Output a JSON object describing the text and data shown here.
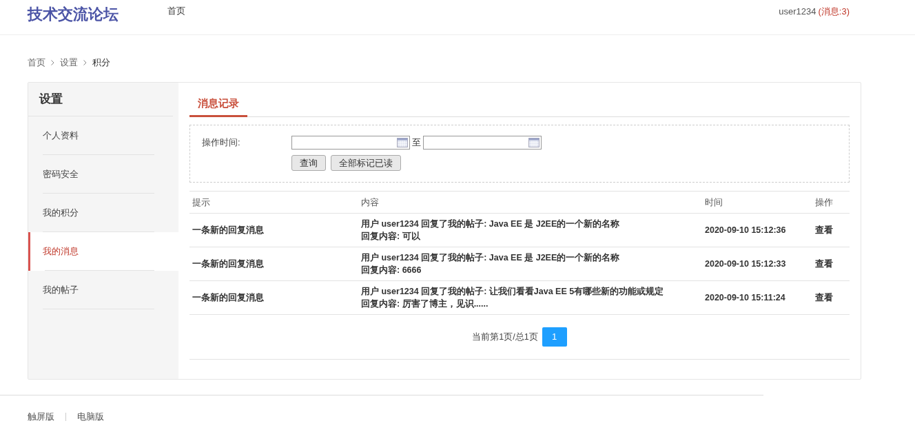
{
  "header": {
    "logo": "技术交流论坛",
    "nav": [
      {
        "label": "首页"
      }
    ],
    "user": {
      "name": "user1234",
      "messages": "(消息:3)"
    }
  },
  "breadcrumb": [
    "首页",
    "设置",
    "积分"
  ],
  "sidebar": {
    "title": "设置",
    "items": [
      {
        "label": "个人资料",
        "selected": false
      },
      {
        "label": "密码安全",
        "selected": false
      },
      {
        "label": "我的积分",
        "selected": false
      },
      {
        "label": "我的消息",
        "selected": true
      },
      {
        "label": "我的帖子",
        "selected": false
      }
    ]
  },
  "tabs": [
    {
      "label": "消息记录",
      "selected": true
    }
  ],
  "filter": {
    "label": "操作时间:",
    "separator": "至",
    "buttons": [
      "查询",
      "全部标记已读"
    ]
  },
  "table": {
    "columns": [
      "提示",
      "内容",
      "时间",
      "操作"
    ],
    "rows": [
      {
        "hint": "一条新的回复消息",
        "content": [
          "用户 user1234 回复了我的帖子: Java EE 是 J2EE的一个新的名称",
          "回复内容: 可以"
        ],
        "time": "2020-09-10 15:12:36",
        "action": "查看"
      },
      {
        "hint": "一条新的回复消息",
        "content": [
          "用户 user1234 回复了我的帖子: Java EE 是 J2EE的一个新的名称",
          "回复内容: 6666"
        ],
        "time": "2020-09-10 15:12:33",
        "action": "查看"
      },
      {
        "hint": "一条新的回复消息",
        "content": [
          "用户 user1234 回复了我的帖子: 让我们看看Java EE 5有哪些新的功能或规定",
          "回复内容: 厉害了博主，见识......"
        ],
        "time": "2020-09-10 15:11:24",
        "action": "查看"
      }
    ]
  },
  "pagination": {
    "info": "当前第1页/总1页",
    "pages": [
      {
        "label": "1",
        "selected": true
      }
    ]
  },
  "footer": [
    "触屏版",
    "电脑版"
  ]
}
